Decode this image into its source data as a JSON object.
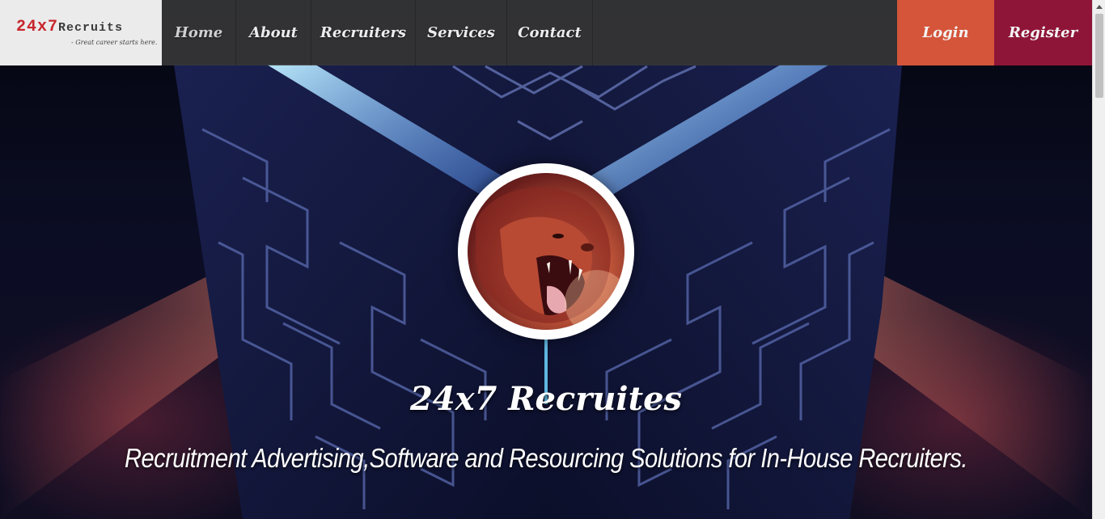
{
  "brand": {
    "number": "24x7",
    "word": "Recruits",
    "tagline": "- Great career starts here."
  },
  "nav": {
    "home": "Home",
    "about": "About",
    "recruiters": "Recruiters",
    "services": "Services",
    "contact": "Contact",
    "login": "Login",
    "register": "Register"
  },
  "hero": {
    "title": "24x7 Recruites",
    "subtitle": "Recruitment Advertising,Software and Resourcing Solutions for In-House Recruiters.",
    "avatar_icon": "roaring-lion-icon"
  },
  "colors": {
    "login_bg": "#d4553a",
    "register_bg": "#8e1538",
    "brand_red": "#c7262c",
    "navbar_bg": "rgba(60,60,60,0.82)"
  }
}
